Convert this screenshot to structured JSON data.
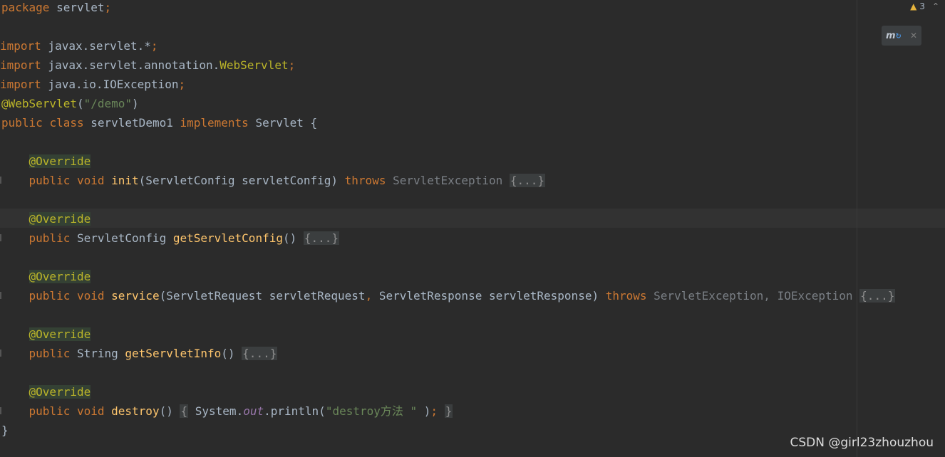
{
  "inspection": {
    "warning_count": "3"
  },
  "watermark": "CSDN @girl23zhouzhou",
  "code": {
    "l01": {
      "kw": "package",
      "rest": " servlet",
      "semi": ";"
    },
    "l03": {
      "kw": "import",
      "rest": " javax.servlet.*",
      "semi": ";"
    },
    "l04": {
      "kw": "import",
      "rest": " javax.servlet.annotation.",
      "cls": "WebServlet",
      "semi": ";"
    },
    "l05": {
      "kw": "import",
      "rest": " java.io.IOException",
      "semi": ";"
    },
    "l06": {
      "ann": "@WebServlet",
      "open": "(",
      "str": "\"/demo\"",
      "close": ")"
    },
    "l07": {
      "kw1": "public",
      "kw2": "class",
      "name": "servletDemo1",
      "kw3": "implements",
      "iface": "Servlet",
      "brace": "{"
    },
    "l09": {
      "ann": "@Override"
    },
    "l10": {
      "kw1": "public",
      "kw2": "void",
      "fn": "init",
      "params": "(ServletConfig servletConfig) ",
      "throws": "throws",
      "exc": "ServletException",
      "fold": "{...}"
    },
    "l12": {
      "ann": "@Override"
    },
    "l13": {
      "kw1": "public",
      "type": "ServletConfig",
      "fn": "getServletConfig",
      "params": "()",
      "fold": "{...}"
    },
    "l15": {
      "ann": "@Override"
    },
    "l16": {
      "kw1": "public",
      "kw2": "void",
      "fn": "service",
      "params1": "(ServletRequest servletRequest",
      "comma1": ",",
      "params2": " ServletResponse servletResponse) ",
      "throws": "throws",
      "exc1": "ServletException",
      "comma2": ",",
      "exc2": "IOException",
      "fold": "{...}"
    },
    "l18": {
      "ann": "@Override"
    },
    "l19": {
      "kw1": "public",
      "type": "String",
      "fn": "getServletInfo",
      "params": "()",
      "fold": "{...}"
    },
    "l21": {
      "ann": "@Override"
    },
    "l22": {
      "kw1": "public",
      "kw2": "void",
      "fn": "destroy",
      "params": "()",
      "fold_open": "{",
      "sys": "System.",
      "field": "out",
      "call": ".println(",
      "str": "\"destroy方法 \"",
      "close": " )",
      "semi": ";",
      "fold_close": "}"
    },
    "l23": {
      "brace": "}"
    }
  },
  "colors": {
    "background": "#2b2b2b",
    "keyword": "#cc7832",
    "annotation": "#bbb529",
    "method": "#ffc66d",
    "string": "#6a8759",
    "text": "#a9b7c6",
    "warning": "#e5b33c"
  },
  "icons": {
    "warning": "warning-triangle-icon",
    "chevron": "chevron-up-icon",
    "maven": "maven-reload-icon",
    "close": "close-icon"
  }
}
